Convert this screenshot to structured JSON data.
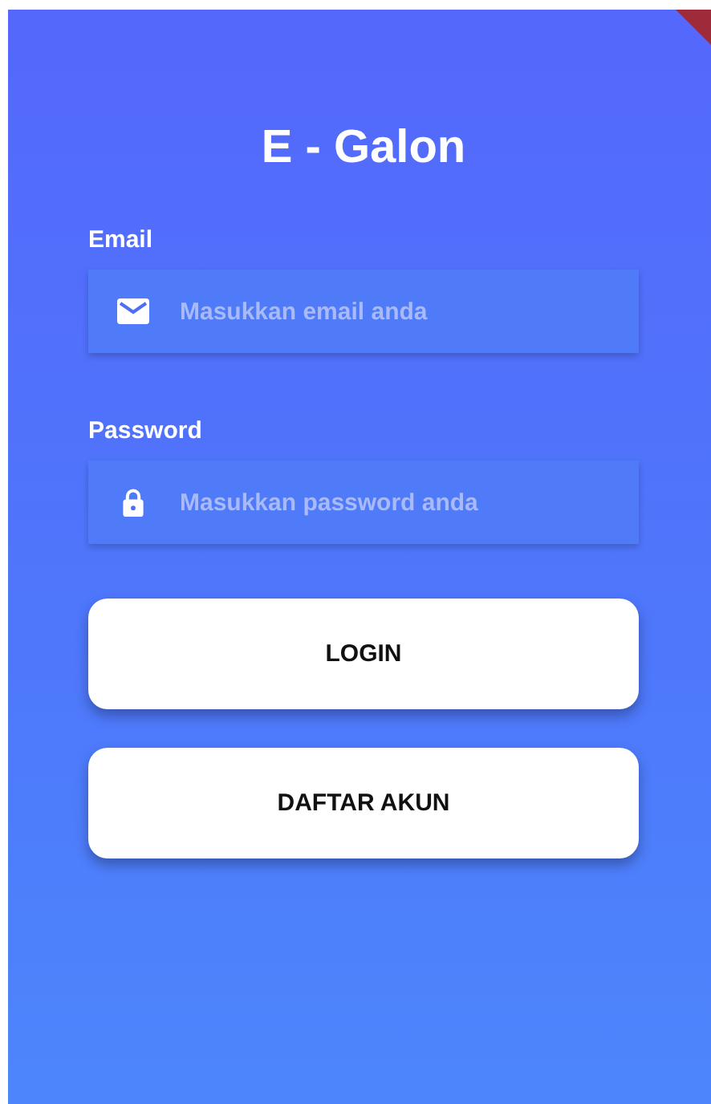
{
  "title": "E - Galon",
  "fields": [
    {
      "kind": "email",
      "label": "Email",
      "placeholder": "Masukkan email anda"
    },
    {
      "kind": "password",
      "label": "Password",
      "placeholder": "Masukkan password anda"
    }
  ],
  "buttons": [
    "LOGIN",
    "DAFTAR AKUN"
  ]
}
